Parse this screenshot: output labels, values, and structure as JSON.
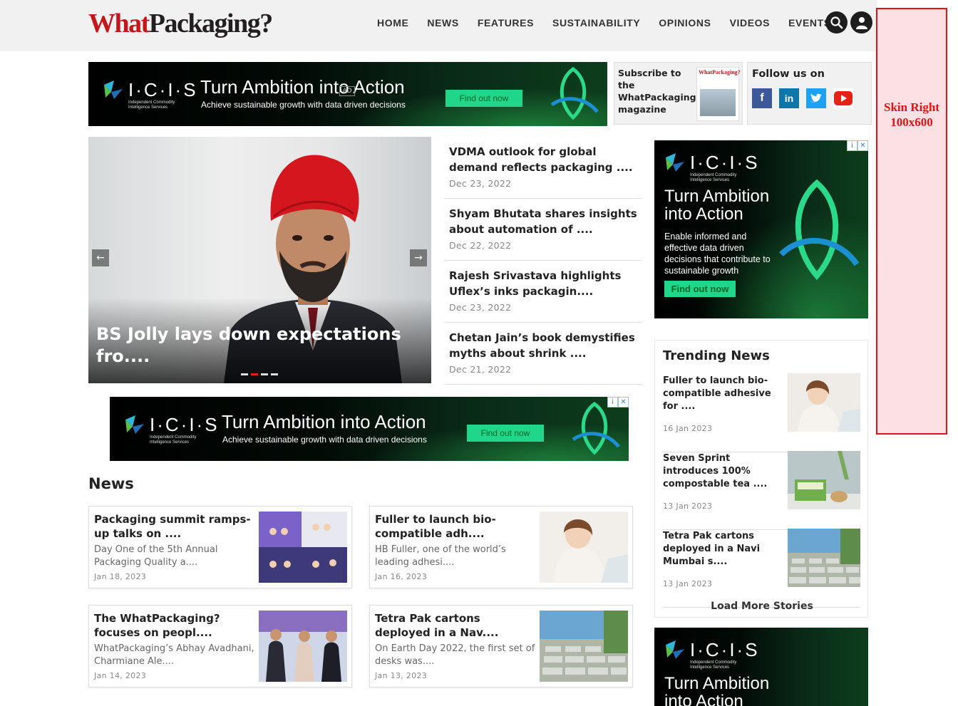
{
  "header": {
    "logo_what": "What",
    "logo_packaging": "Packaging?",
    "nav": [
      "HOME",
      "NEWS",
      "FEATURES",
      "SUSTAINABILITY",
      "OPINIONS",
      "VIDEOS",
      "EVENTS"
    ]
  },
  "skin": {
    "line1": "Skin Right",
    "line2": "100x600"
  },
  "ads": {
    "brand": "I·C·I·S",
    "brand_sub": "Independent Commodity Intelligence Services",
    "title": "Turn Ambition into Action",
    "title_line1": "Turn Ambition",
    "title_line2": "into Action",
    "subtitle": "Achieve sustainable growth with data driven decisions",
    "side_body": "Enable informed and effective data driven decisions that contribute to sustainable growth",
    "cta": "Find out now",
    "ad_tag": "AD"
  },
  "subscribe": {
    "text": "Subscribe to the WhatPackaging magazine",
    "mag_title": "WhatPackaging?"
  },
  "follow": {
    "title": "Follow us on",
    "networks": [
      "facebook",
      "linkedin",
      "twitter",
      "youtube"
    ]
  },
  "hero": {
    "caption": "BS Jolly lays down expectations fro....",
    "prev": "←",
    "next": "→"
  },
  "latest": [
    {
      "title": "VDMA outlook for global demand reflects packaging ....",
      "date": "Dec 23, 2022"
    },
    {
      "title": "Shyam Bhutata shares insights about automation of ....",
      "date": "Dec 22, 2022"
    },
    {
      "title": "Rajesh Srivastava highlights Uflex’s inks packagin....",
      "date": "Dec 23, 2022"
    },
    {
      "title": "Chetan Jain’s book demystifies myths about shrink ....",
      "date": "Dec 21, 2022"
    }
  ],
  "news": {
    "heading": "News",
    "cards": [
      {
        "title": "Packaging summit ramps-up talks on ....",
        "excerpt": "Day One of the 5th Annual Packaging Quality a....",
        "date": "Jan 18, 2023"
      },
      {
        "title": "Fuller to launch bio-compatible adh....",
        "excerpt": "HB Fuller, one of the world’s leading adhesi....",
        "date": "Jan 16, 2023"
      },
      {
        "title": "The WhatPackaging? focuses on peopl....",
        "excerpt": "WhatPackaging’s Abhay Avadhani, Charmiane Ale....",
        "date": "Jan 14, 2023"
      },
      {
        "title": "Tetra Pak cartons deployed in a Nav....",
        "excerpt": "On Earth Day 2022, the first set of desks was....",
        "date": "Jan 13, 2023"
      }
    ]
  },
  "trending": {
    "title": "Trending News",
    "items": [
      {
        "title": "Fuller to launch bio-compatible adhesive for ....",
        "date": "16 Jan 2023"
      },
      {
        "title": "Seven Sprint introduces 100% compostable tea ....",
        "date": "13 Jan 2023"
      },
      {
        "title": "Tetra Pak cartons deployed in a Navi Mumbai s....",
        "date": "13 Jan 2023"
      }
    ],
    "load_more": "Load More Stories"
  }
}
